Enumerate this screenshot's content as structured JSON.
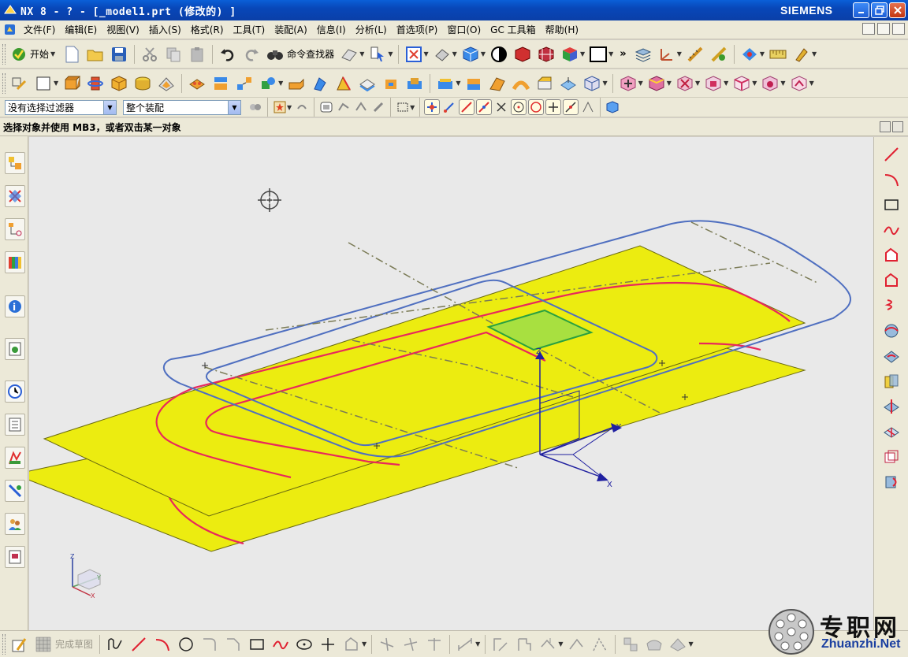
{
  "window": {
    "title": "NX 8 - ? - [_model1.prt  (修改的) ]",
    "brand": "SIEMENS",
    "controls": [
      "minimize-icon",
      "restore-icon",
      "close-icon"
    ]
  },
  "menubar": {
    "items": [
      "文件(F)",
      "编辑(E)",
      "视图(V)",
      "插入(S)",
      "格式(R)",
      "工具(T)",
      "装配(A)",
      "信息(I)",
      "分析(L)",
      "首选项(P)",
      "窗口(O)",
      "GC 工具箱",
      "帮助(H)"
    ]
  },
  "toolbar_standard": {
    "start_label": "开始",
    "command_finder_label": "命令查找器",
    "overflow": "»"
  },
  "selection_bar": {
    "filter_value": "没有选择过滤器",
    "scope_value": "整个装配"
  },
  "cue_line": {
    "text": "选择对象并使用 MB3，或者双击某一对象"
  },
  "sketch_toolbar": {
    "finish_label": "完成草图"
  },
  "csys": {
    "x_label": "X",
    "y_label": "Y",
    "z_label": "Z"
  },
  "watermark": {
    "chinese": "专职网",
    "url": "Zhuanzhi.Net"
  },
  "colors": {
    "titlebar": "#0a47b8",
    "surface_fill": "#ecec10",
    "curve_red": "#e8285c",
    "curve_blue": "#4f6fc0",
    "face_highlight": "#a8e040"
  }
}
